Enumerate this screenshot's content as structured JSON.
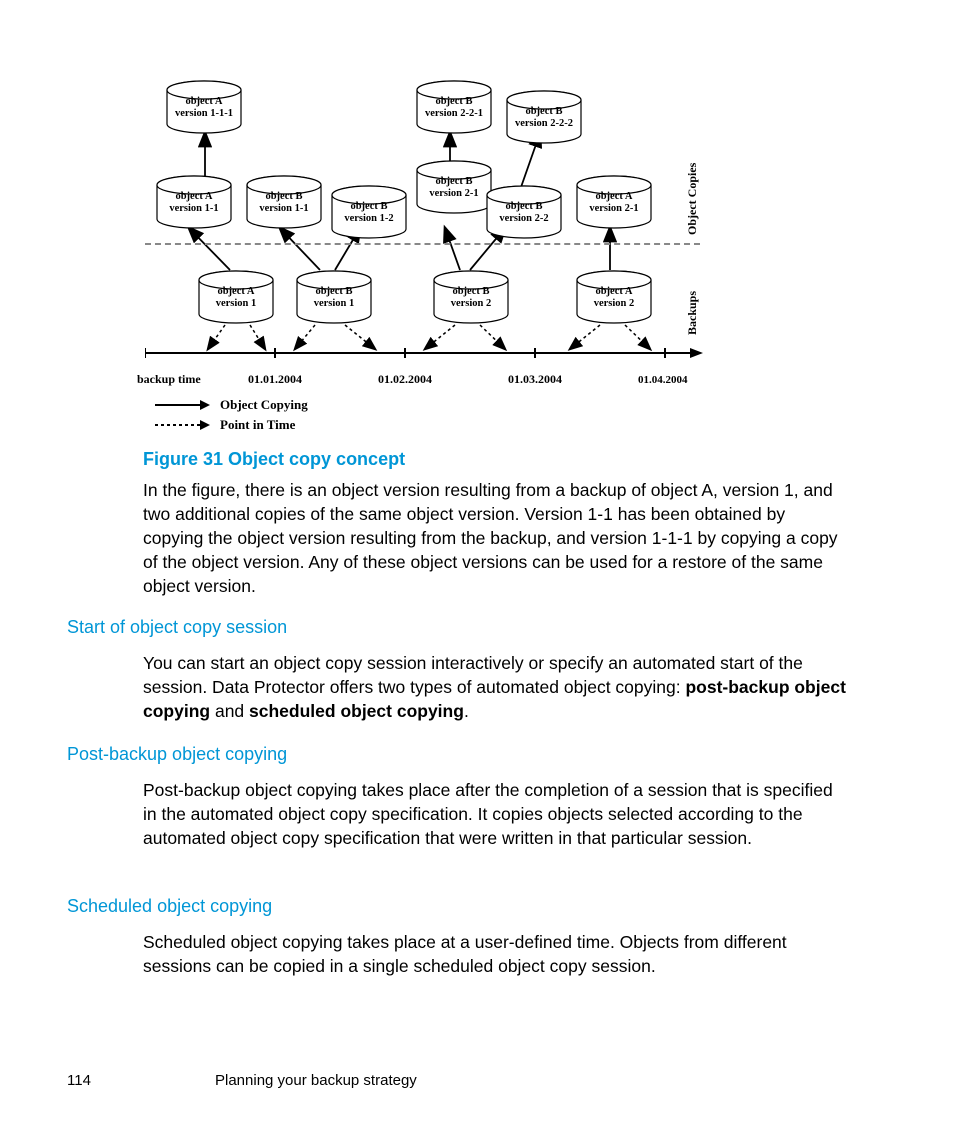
{
  "figure": {
    "caption": "Figure 31 Object copy concept",
    "section_label_copies": "Object Copies",
    "section_label_backups": "Backups",
    "x_axis_label": "backup time",
    "x_ticks": [
      "01.01.2004",
      "01.02.2004",
      "01.03.2004",
      "01.04.2004"
    ],
    "legend_solid": "Object Copying",
    "legend_dashed": "Point in Time",
    "cylinders": {
      "r0": [
        {
          "l1": "object A",
          "l2": "version 1-1-1"
        },
        {
          "l1": "object B",
          "l2": "version 2-2-1"
        },
        {
          "l1": "object B",
          "l2": "version 2-2-2"
        }
      ],
      "r1": [
        {
          "l1": "object A",
          "l2": "version 1-1"
        },
        {
          "l1": "object B",
          "l2": "version 1-1"
        },
        {
          "l1": "object B",
          "l2": "version 1-2"
        },
        {
          "l1": "object B",
          "l2": "version 2-1"
        },
        {
          "l1": "object B",
          "l2": "version 2-2"
        },
        {
          "l1": "object A",
          "l2": "version 2-1"
        }
      ],
      "r2": [
        {
          "l1": "object A",
          "l2": "version 1"
        },
        {
          "l1": "object  B",
          "l2": "version 1"
        },
        {
          "l1": "object B",
          "l2": "version 2"
        },
        {
          "l1": "object A",
          "l2": "version 2"
        }
      ]
    }
  },
  "paragraphs": {
    "p1": "In the figure, there is an object version resulting from a backup of object A, version 1, and two additional copies of the same object version. Version 1-1 has been obtained by copying the object version resulting from the backup, and version 1-1-1 by copying a copy of the object version. Any of these object versions can be used for a restore of the same object version.",
    "p2a": "You can start an object copy session interactively or specify an automated start of the session. Data Protector offers two types of automated object copying: ",
    "p2b_bold": "post-backup object copying",
    "p2c": " and ",
    "p2d_bold": "scheduled object copying",
    "p2e": ".",
    "p3": "Post-backup object copying takes place after the completion of a session that is specified in the automated object copy specification. It copies objects selected according to the automated object copy specification that were written in that particular session.",
    "p4": "Scheduled object copying takes place at a user-defined time. Objects from different sessions can be copied in a single scheduled object copy session."
  },
  "headings": {
    "h1": "Start of object copy session",
    "h2": "Post-backup object copying",
    "h3": "Scheduled object copying"
  },
  "footer": {
    "page_number": "114",
    "chapter": "Planning your backup strategy"
  }
}
